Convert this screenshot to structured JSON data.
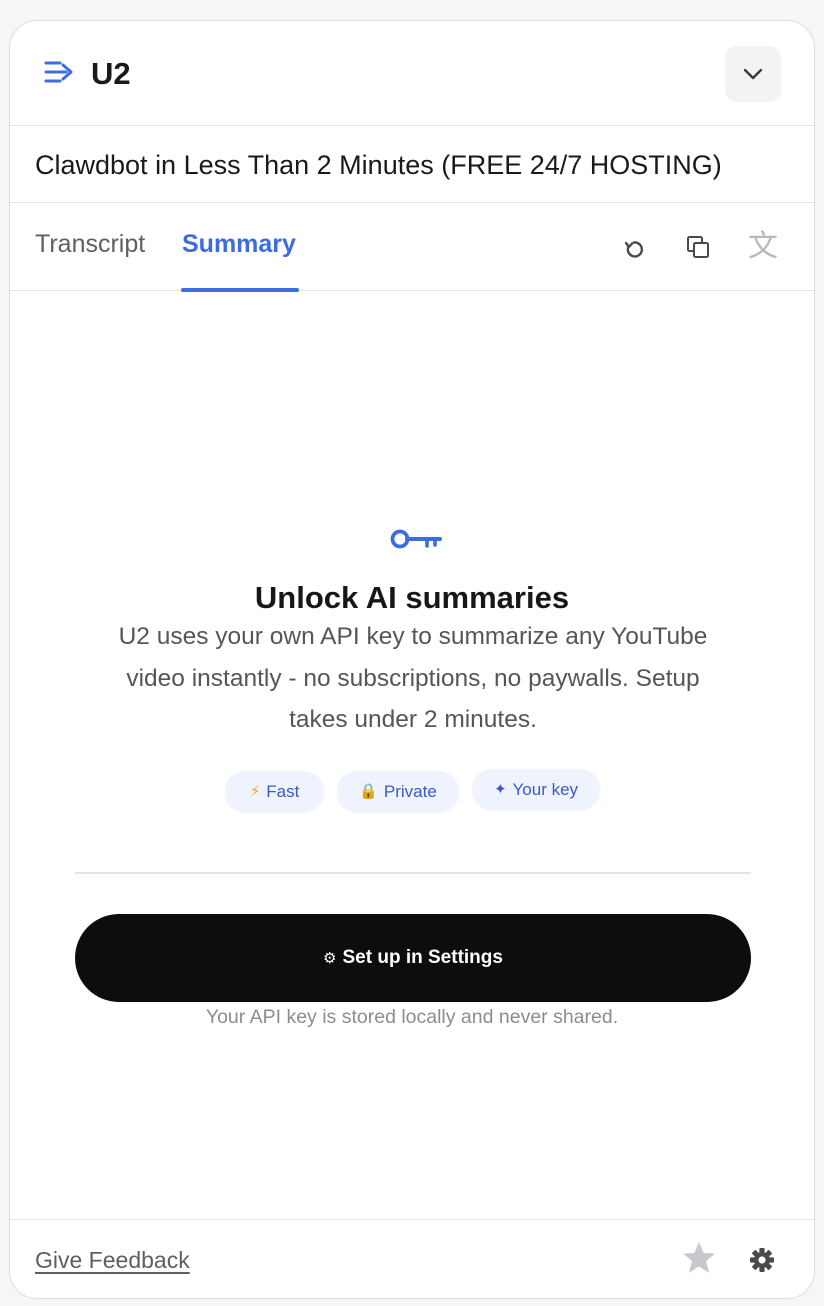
{
  "header": {
    "app_title": "U2",
    "logo_icon": "list-arrow-icon",
    "collapse_icon": "chevron-down-icon"
  },
  "video": {
    "title": "Clawdbot in Less Than 2 Minutes (FREE 24/7 HOSTING)"
  },
  "tabs": [
    {
      "label": "Transcript",
      "active": false
    },
    {
      "label": "Summary",
      "active": true
    }
  ],
  "toolbar": {
    "refresh_icon": "refresh-icon",
    "copy_icon": "copy-icon",
    "translate_icon": "translate-icon",
    "translate_glyph": "文"
  },
  "summary_empty": {
    "icon": "key-icon",
    "title": "Unlock AI summaries",
    "description": "U2 uses your own API key to summarize any YouTube video instantly - no subscriptions, no paywalls. Setup takes under 2 minutes.",
    "pills": [
      {
        "icon": "⚡",
        "label": "Fast"
      },
      {
        "icon": "🔒",
        "label": "Private"
      },
      {
        "icon": "✦",
        "label": "Your key"
      }
    ],
    "setup_button": {
      "icon": "⚙",
      "label": "Set up in Settings"
    },
    "privacy_note": "Your API key is stored locally and never shared."
  },
  "footer": {
    "feedback_label": "Give Feedback",
    "star_icon": "star-icon",
    "settings_icon": "gear-icon"
  },
  "colors": {
    "accent": "#3d6be0",
    "button_bg": "#0d0d0d",
    "pill_bg": "#eef3fd",
    "pill_text": "#3c58c4"
  }
}
